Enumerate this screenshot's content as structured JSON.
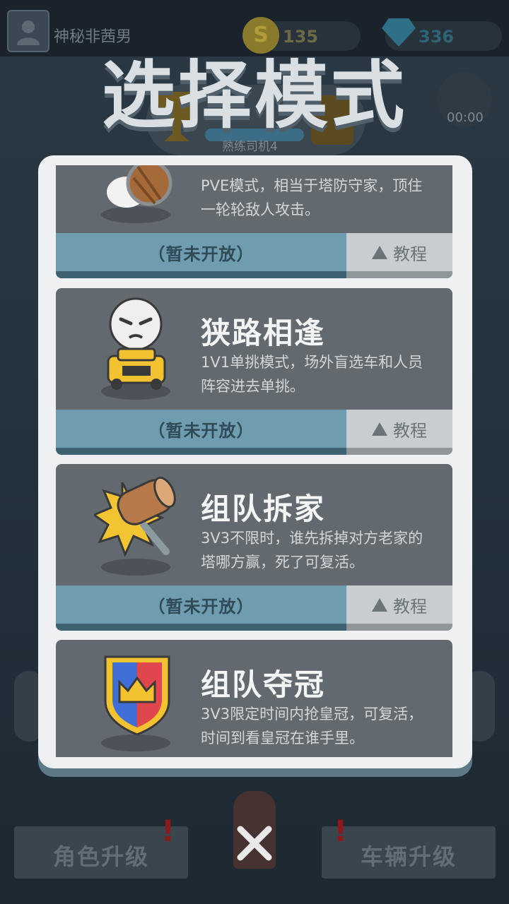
{
  "background": {
    "player_name": "神秘非茜男",
    "coins": "135",
    "coin_symbol": "S",
    "gems": "336",
    "rank_label": "熟练司机4",
    "timer": "00:00",
    "left_button": "角色升级",
    "right_button": "车辆升级",
    "alert_mark": "!"
  },
  "title": "选择模式",
  "modes": [
    {
      "icon": "bunny-with-shield-icon",
      "name": "",
      "description": "PVE模式，相当于塔防守家，顶住一轮轮敌人攻击。",
      "status": "（暂未开放）",
      "tutorial": "教程"
    },
    {
      "icon": "angry-driver-car-icon",
      "name": "狭路相逢",
      "description": "1V1单挑模式，场外盲选车和人员阵容进去单挑。",
      "status": "（暂未开放）",
      "tutorial": "教程"
    },
    {
      "icon": "wooden-hammer-icon",
      "name": "组队拆家",
      "description": "3V3不限时，谁先拆掉对方老家的塔哪方赢，死了可复活。",
      "status": "（暂未开放）",
      "tutorial": "教程"
    },
    {
      "icon": "crown-shield-icon",
      "name": "组队夺冠",
      "description": "3V3限定时间内抢皇冠，可复活，时间到看皇冠在谁手里。",
      "status": "",
      "tutorial": ""
    }
  ],
  "close_icon": "close-x-icon",
  "colors": {
    "card_body": "#626a70",
    "status_bar": "#6f9cae",
    "tutorial_button": "#c8cdd0",
    "modal": "#eef0f1",
    "title_text": "#d9dfe2"
  }
}
